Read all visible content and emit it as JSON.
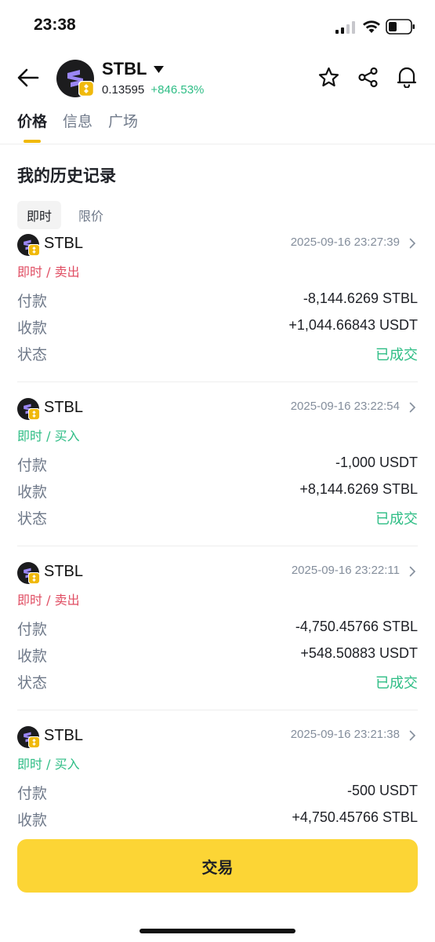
{
  "status_bar": {
    "time": "23:38"
  },
  "header": {
    "coin_name": "STBL",
    "price": "0.13595",
    "change": "+846.53%"
  },
  "tabs": [
    {
      "label": "价格",
      "active": true
    },
    {
      "label": "信息",
      "active": false
    },
    {
      "label": "广场",
      "active": false
    }
  ],
  "section_title": "我的历史记录",
  "subtabs": [
    {
      "label": "即时",
      "active": true
    },
    {
      "label": "限价",
      "active": false
    }
  ],
  "labels": {
    "pay": "付款",
    "receive": "收款",
    "status": "状态"
  },
  "records": [
    {
      "name": "STBL",
      "time": "2025-09-16 23:27:39",
      "type": "即时 / 卖出",
      "side": "sell",
      "pay": "-8,144.6269 STBL",
      "receive": "+1,044.66843 USDT",
      "status": "已成交"
    },
    {
      "name": "STBL",
      "time": "2025-09-16 23:22:54",
      "type": "即时 / 买入",
      "side": "buy",
      "pay": "-1,000 USDT",
      "receive": "+8,144.6269 STBL",
      "status": "已成交"
    },
    {
      "name": "STBL",
      "time": "2025-09-16 23:22:11",
      "type": "即时 / 卖出",
      "side": "sell",
      "pay": "-4,750.45766 STBL",
      "receive": "+548.50883 USDT",
      "status": "已成交"
    },
    {
      "name": "STBL",
      "time": "2025-09-16 23:21:38",
      "type": "即时 / 买入",
      "side": "buy",
      "pay": "-500 USDT",
      "receive": "+4,750.45766 STBL",
      "status": ""
    }
  ],
  "trade_button": "交易",
  "colors": {
    "sell": "#e04e63",
    "buy": "#2ebd85",
    "accent": "#fcd535"
  }
}
